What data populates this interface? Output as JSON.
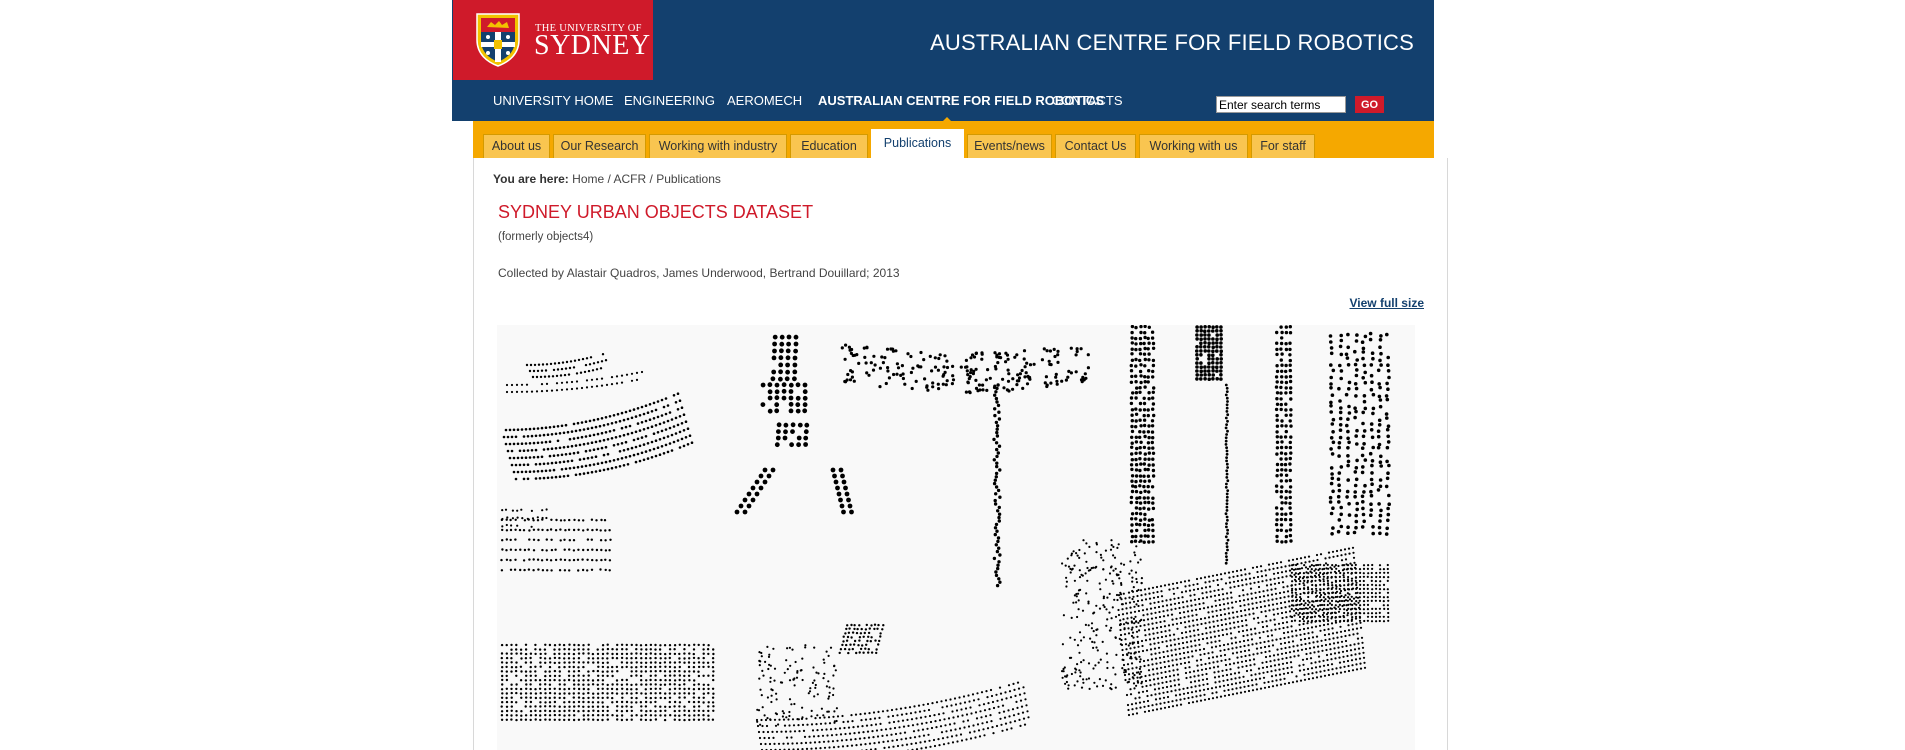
{
  "logo": {
    "line1": "THE UNIVERSITY OF",
    "line2": "SYDNEY"
  },
  "site_title": "AUSTRALIAN CENTRE FOR FIELD ROBOTICS",
  "topnav": [
    "UNIVERSITY HOME",
    "ENGINEERING",
    "AEROMECH",
    "AUSTRALIAN CENTRE FOR FIELD ROBOTICS",
    "CONTACTS"
  ],
  "search": {
    "value": "Enter search terms",
    "button": "GO"
  },
  "tabs": [
    "About us",
    "Our Research",
    "Working with industry",
    "Education",
    "Publications",
    "Events/news",
    "Contact Us",
    "Working with us",
    "For staff"
  ],
  "breadcrumb": {
    "label": "You are here:",
    "items": [
      "Home",
      "ACFR",
      "Publications"
    ],
    "separator": " / "
  },
  "page": {
    "title": "SYDNEY URBAN OBJECTS DATASET",
    "subtitle": "(formerly objects4)",
    "collected": "Collected by Alastair Quadros, James Underwood, Bertrand Douillard; 2013",
    "view_full": "View full size"
  },
  "colors": {
    "navy": "#13406e",
    "red": "#cf1a2a",
    "gold": "#f5a800",
    "tab": "#f9c550"
  }
}
